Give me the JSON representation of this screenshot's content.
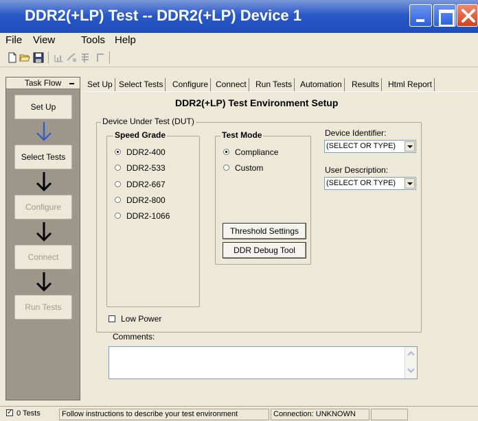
{
  "window": {
    "title": "DDR2(+LP) Test -- DDR2(+LP) Device 1"
  },
  "menu": [
    "File",
    "View",
    "Tools",
    "Help"
  ],
  "taskflow": {
    "header": "Task Flow",
    "steps": [
      {
        "label": "Set Up",
        "state": "active"
      },
      {
        "label": "Select Tests",
        "state": "active"
      },
      {
        "label": "Configure",
        "state": "disabled"
      },
      {
        "label": "Connect",
        "state": "disabled"
      },
      {
        "label": "Run Tests",
        "state": "disabled"
      }
    ]
  },
  "tabs": [
    "Set Up",
    "Select Tests",
    "Configure",
    "Connect",
    "Run Tests",
    "Automation",
    "Results",
    "Html Report"
  ],
  "setup": {
    "title": "DDR2(+LP) Test Environment Setup",
    "dut_group": "Device Under Test (DUT)",
    "speed_grade": {
      "label": "Speed Grade",
      "options": [
        "DDR2-400",
        "DDR2-533",
        "DDR2-667",
        "DDR2-800",
        "DDR2-1066"
      ],
      "selected": "DDR2-400"
    },
    "test_mode": {
      "label": "Test Mode",
      "options": [
        "Compliance",
        "Custom"
      ],
      "selected": "Compliance"
    },
    "threshold_button": "Threshold Settings",
    "debug_button": "DDR Debug Tool",
    "device_identifier": {
      "label": "Device Identifier:",
      "value": "(SELECT OR TYPE)"
    },
    "user_description": {
      "label": "User Description:",
      "value": "(SELECT OR TYPE)"
    },
    "low_power": {
      "label": "Low Power",
      "checked": false
    },
    "comments_label": "Comments:",
    "comments_value": ""
  },
  "status": {
    "tests": "0 Tests",
    "message": "Follow instructions to describe your test environment",
    "connection": "Connection: UNKNOWN"
  }
}
